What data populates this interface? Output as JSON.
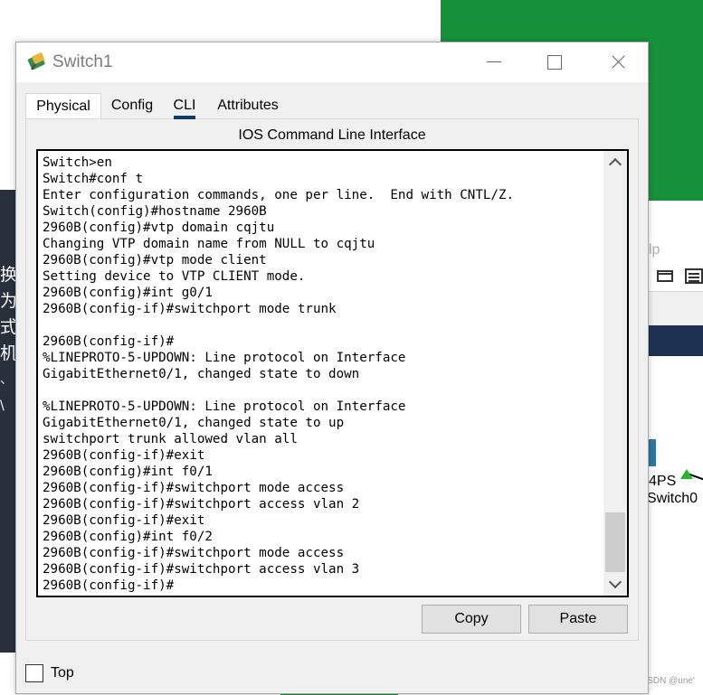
{
  "background": {
    "sidebar_chars": [
      "换",
      "为",
      "式",
      "机",
      "、",
      "\\"
    ],
    "panel_fragment": "lp",
    "device_model_fragment": "4PS",
    "device_name_fragment": "Switch0",
    "watermark": "CSDN @une'"
  },
  "window": {
    "title": "Switch1",
    "tabs": [
      {
        "label": "Physical"
      },
      {
        "label": "Config"
      },
      {
        "label": "CLI"
      },
      {
        "label": "Attributes"
      }
    ],
    "active_tab": "CLI",
    "heading": "IOS Command Line Interface",
    "terminal_lines": [
      "Switch>en",
      "Switch#conf t",
      "Enter configuration commands, one per line.  End with CNTL/Z.",
      "Switch(config)#hostname 2960B",
      "2960B(config)#vtp domain cqjtu",
      "Changing VTP domain name from NULL to cqjtu",
      "2960B(config)#vtp mode client",
      "Setting device to VTP CLIENT mode.",
      "2960B(config)#int g0/1",
      "2960B(config-if)#switchport mode trunk",
      "",
      "2960B(config-if)#",
      "%LINEPROTO-5-UPDOWN: Line protocol on Interface",
      "GigabitEthernet0/1, changed state to down",
      "",
      "%LINEPROTO-5-UPDOWN: Line protocol on Interface",
      "GigabitEthernet0/1, changed state to up",
      "switchport trunk allowed vlan all",
      "2960B(config-if)#exit",
      "2960B(config)#int f0/1",
      "2960B(config-if)#switchport mode access",
      "2960B(config-if)#switchport access vlan 2",
      "2960B(config-if)#exit",
      "2960B(config)#int f0/2",
      "2960B(config-if)#switchport mode access",
      "2960B(config-if)#switchport access vlan 3",
      "2960B(config-if)#"
    ],
    "buttons": {
      "copy": "Copy",
      "paste": "Paste"
    },
    "top_label": "Top",
    "top_checked": false
  },
  "colors": {
    "desktop_green": "#16913a",
    "tab_underline": "#123a66",
    "device_link_green": "#29b529"
  }
}
